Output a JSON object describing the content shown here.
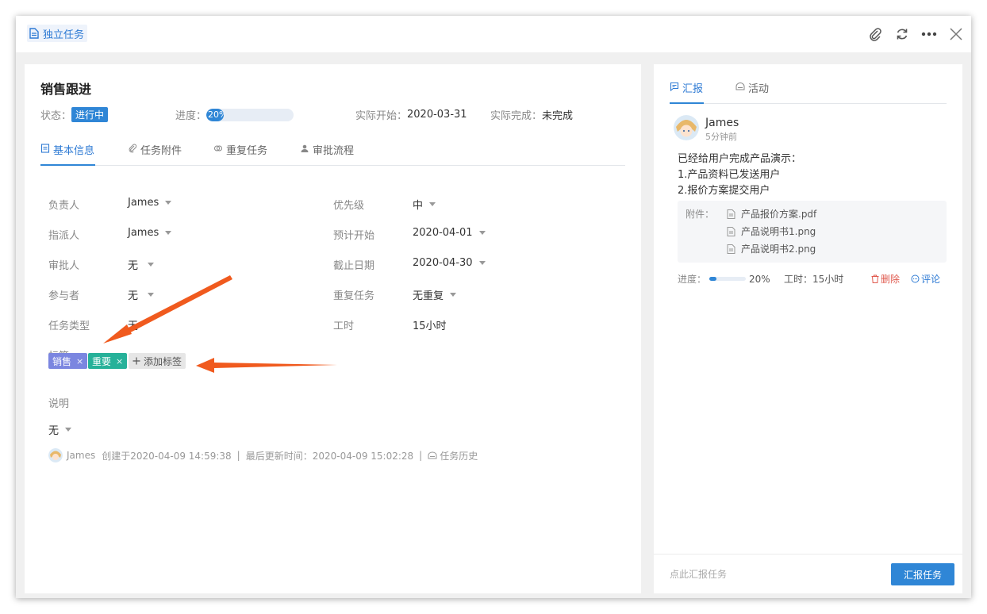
{
  "header": {
    "task_type": "独立任务",
    "icons": [
      "paperclip-icon",
      "refresh-icon",
      "more-icon",
      "close-icon"
    ]
  },
  "task": {
    "title": "销售跟进",
    "status_label": "状态：",
    "status_value": "进行中",
    "progress_label": "进度：",
    "progress_text": "20%",
    "progress_fraction": 0.2,
    "start_label": "实际开始：",
    "start_value": "2020-03-31",
    "finish_label": "实际完成：",
    "finish_value": "未完成"
  },
  "tabs": [
    {
      "label": "基本信息",
      "icon": "document-icon"
    },
    {
      "label": "任务附件",
      "icon": "paperclip-icon"
    },
    {
      "label": "重复任务",
      "icon": "repeat-icon"
    },
    {
      "label": "审批流程",
      "icon": "user-icon"
    }
  ],
  "fields": {
    "owner_label": "负责人",
    "owner_value": "James",
    "assigner_label": "指派人",
    "assigner_value": "James",
    "approver_label": "审批人",
    "approver_value": "无",
    "participants_label": "参与者",
    "participants_value": "无",
    "type_label": "任务类型",
    "type_value": "无",
    "priority_label": "优先级",
    "priority_value": "中",
    "plan_start_label": "预计开始",
    "plan_start_value": "2020-04-01",
    "deadline_label": "截止日期",
    "deadline_value": "2020-04-30",
    "repeat_label": "重复任务",
    "repeat_value": "无重复",
    "hours_label": "工时",
    "hours_value": "15小时",
    "tags_label": "标签",
    "desc_label": "说明",
    "desc_value": "无"
  },
  "tags": [
    {
      "label": "销售",
      "color": "#7b86e0"
    },
    {
      "label": "重要",
      "color": "#26b199"
    }
  ],
  "add_tag_label": "添加标签",
  "tag_remove": "×",
  "footer": {
    "user": "James",
    "created": "创建于2020-04-09 14:59:38",
    "sep": "|",
    "updated": "最后更新时间：2020-04-09 15:02:28",
    "history": "任务历史"
  },
  "right": {
    "tabs": [
      {
        "label": "汇报",
        "icon": "comment-icon"
      },
      {
        "label": "活动",
        "icon": "activity-icon"
      }
    ],
    "report": {
      "user": "James",
      "time": "5分钟前",
      "lines": [
        "已经给用户完成产品演示：",
        "1.产品资料已发送用户",
        "2.报价方案提交用户"
      ],
      "attach_label": "附件：",
      "files": [
        "产品报价方案.pdf",
        "产品说明书1.png",
        "产品说明书2.png"
      ],
      "progress_label": "进度：",
      "progress_text": "20%",
      "progress_fraction": 0.2,
      "hours": "工时：15小时",
      "delete": "删除",
      "comment": "评论"
    },
    "placeholder": "点此汇报任务",
    "submit": "汇报任务"
  },
  "colors": {
    "accent": "#2f86d6",
    "delete": "#e05a4f",
    "arrow": "#f05a1e"
  }
}
